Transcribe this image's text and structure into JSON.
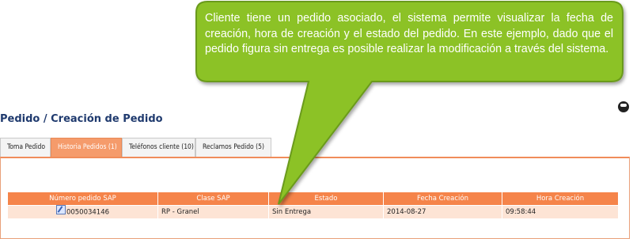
{
  "title": "Pedido / Creación de Pedido",
  "tabs": [
    {
      "label": "Toma Pedido",
      "active": false
    },
    {
      "label": "Historia Pedidos (1)",
      "active": true
    },
    {
      "label": "Teléfonos cliente (10)",
      "active": false
    },
    {
      "label": "Reclamos Pedido (5)",
      "active": false
    }
  ],
  "table": {
    "headers": [
      "Número pedido SAP",
      "Clase SAP",
      "Estado",
      "Fecha Creación",
      "Hora Creación"
    ],
    "rows": [
      {
        "numero": "0050034146",
        "clase": "RP - Granel",
        "estado": "Sin Entrega",
        "fecha": "2014-08-27",
        "hora": "09:58:44"
      }
    ]
  },
  "callout": {
    "text": "Cliente tiene un pedido asociado, el sistema permite visualizar la fecha de creación, hora de creación y el estado del pedido. En este ejemplo, dado que el pedido figura sin entrega es posible realizar la modificación a través del sistema.",
    "fill": "#8cc226",
    "border": "#6a9a1a"
  },
  "colors": {
    "accent": "#f5844a",
    "row_bg": "#fde4d5",
    "title": "#1f3a6e"
  },
  "icons": [
    "edit-icon",
    "toggle-icon"
  ]
}
